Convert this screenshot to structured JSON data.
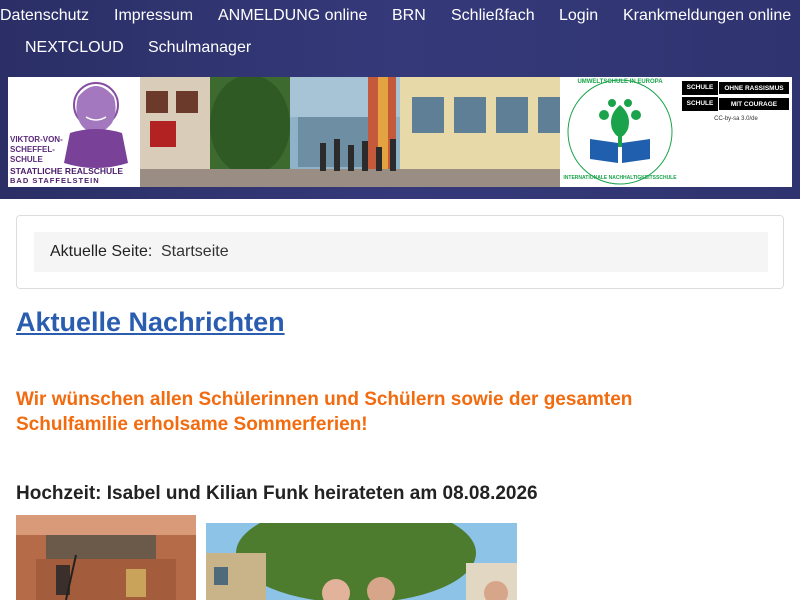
{
  "nav": {
    "items": [
      {
        "label": "Datenschutz"
      },
      {
        "label": "Impressum"
      },
      {
        "label": "ANMELDUNG online"
      },
      {
        "label": "BRN"
      },
      {
        "label": "Schließfach"
      },
      {
        "label": "Login"
      },
      {
        "label": "Krankmeldungen online"
      },
      {
        "label": "NEXTCLOUD"
      },
      {
        "label": "Schulmanager"
      }
    ]
  },
  "banner": {
    "school_logo": {
      "name_lines": [
        "VIKTOR-VON-",
        "SCHEFFEL-",
        "SCHULE"
      ],
      "type": "STAATLICHE REALSCHULE",
      "city": "BAD STAFFELSTEIN"
    },
    "eco_badge": {
      "top_text": "UMWELTSCHULE IN EUROPA",
      "bottom_text": "INTERNATIONALE NACHHALTIGKEITSSCHULE"
    },
    "sor_badge": {
      "row1_a": "SCHULE",
      "row1_b": "OHNE RASSISMUS",
      "row2_a": "SCHULE",
      "row2_b": "MIT COURAGE",
      "license": "CC-by-sa 3.0/de"
    }
  },
  "breadcrumb": {
    "label": "Aktuelle Seite:",
    "current": "Startseite"
  },
  "main": {
    "headline": "Aktuelle Nachrichten",
    "summer_message": "Wir wünschen allen Schülerinnen und Schülern sowie der gesamten Schulfamilie erholsame Sommerferien!",
    "article_title": "Hochzeit: Isabel und Kilian Funk heirateten am 08.08.2026"
  },
  "colors": {
    "header_bg": "#2f3470",
    "link_blue": "#2a5db0",
    "highlight_orange": "#f26b0f",
    "crumb_bg": "#f5f5f5"
  }
}
